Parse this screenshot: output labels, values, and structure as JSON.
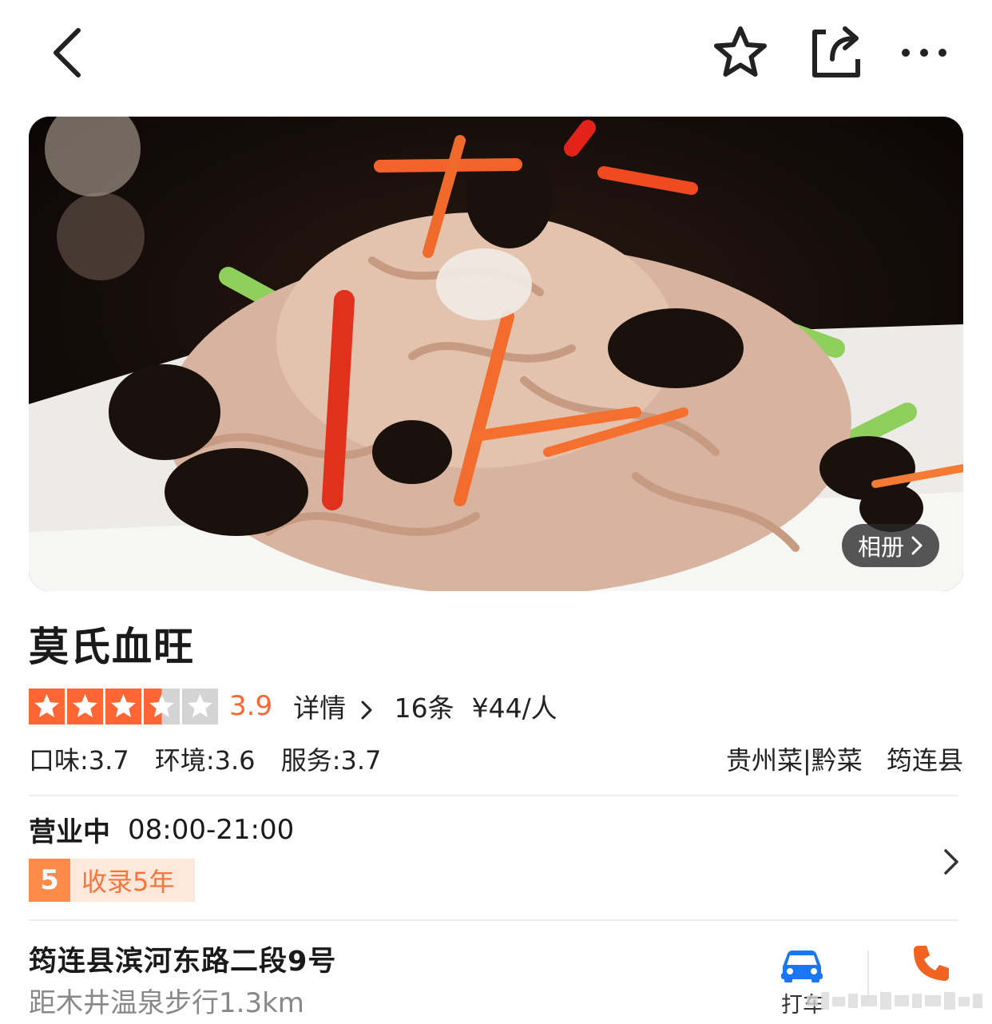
{
  "nav": {
    "back_icon": "chevron-left-icon",
    "favorite_icon": "star-outline-icon",
    "share_icon": "share-icon",
    "more_icon": "more-dots-icon"
  },
  "hero": {
    "album_label": "相册"
  },
  "shop": {
    "name": "莫氏血旺",
    "stars": 3.5,
    "score": "3.9",
    "detail_label": "详情",
    "review_count": "16条",
    "price": "¥44/人",
    "taste": "口味:3.7",
    "environment": "环境:3.6",
    "service": "服务:3.7",
    "cuisine": "贵州菜|黔菜",
    "area": "筠连县"
  },
  "business": {
    "status": "营业中",
    "hours": "08:00-21:00",
    "badge_num": "5",
    "badge_text": "收录5年"
  },
  "location": {
    "address": "筠连县滨河东路二段9号",
    "distance": "距木井温泉步行1.3km",
    "taxi_label": "打车"
  },
  "colors": {
    "accent": "#ff6633",
    "badge_bg": "#fde9dc",
    "badge_num_bg": "#ff8b4a",
    "car_blue": "#1a76f2"
  }
}
